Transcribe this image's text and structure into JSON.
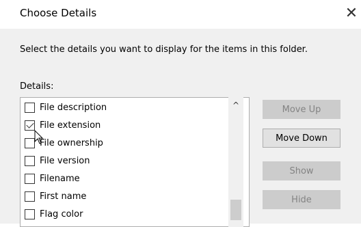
{
  "dialog": {
    "title": "Choose Details",
    "close_glyph": "✕",
    "instructions": "Select the details you want to display for the items in this folder.",
    "details_label": "Details:"
  },
  "details_list": {
    "items": [
      {
        "label": "File description",
        "checked": false
      },
      {
        "label": "File extension",
        "checked": true
      },
      {
        "label": "File ownership",
        "checked": false
      },
      {
        "label": "File version",
        "checked": false
      },
      {
        "label": "Filename",
        "checked": false
      },
      {
        "label": "First name",
        "checked": false
      },
      {
        "label": "Flag color",
        "checked": false
      }
    ],
    "scroll_up_glyph": "^"
  },
  "buttons": {
    "move_up": {
      "label": "Move Up",
      "enabled": false
    },
    "move_down": {
      "label": "Move Down",
      "enabled": true
    },
    "show": {
      "label": "Show",
      "enabled": false
    },
    "hide": {
      "label": "Hide",
      "enabled": false
    }
  },
  "colors": {
    "background": "#f0f0f0",
    "button_disabled_text": "#838383"
  }
}
